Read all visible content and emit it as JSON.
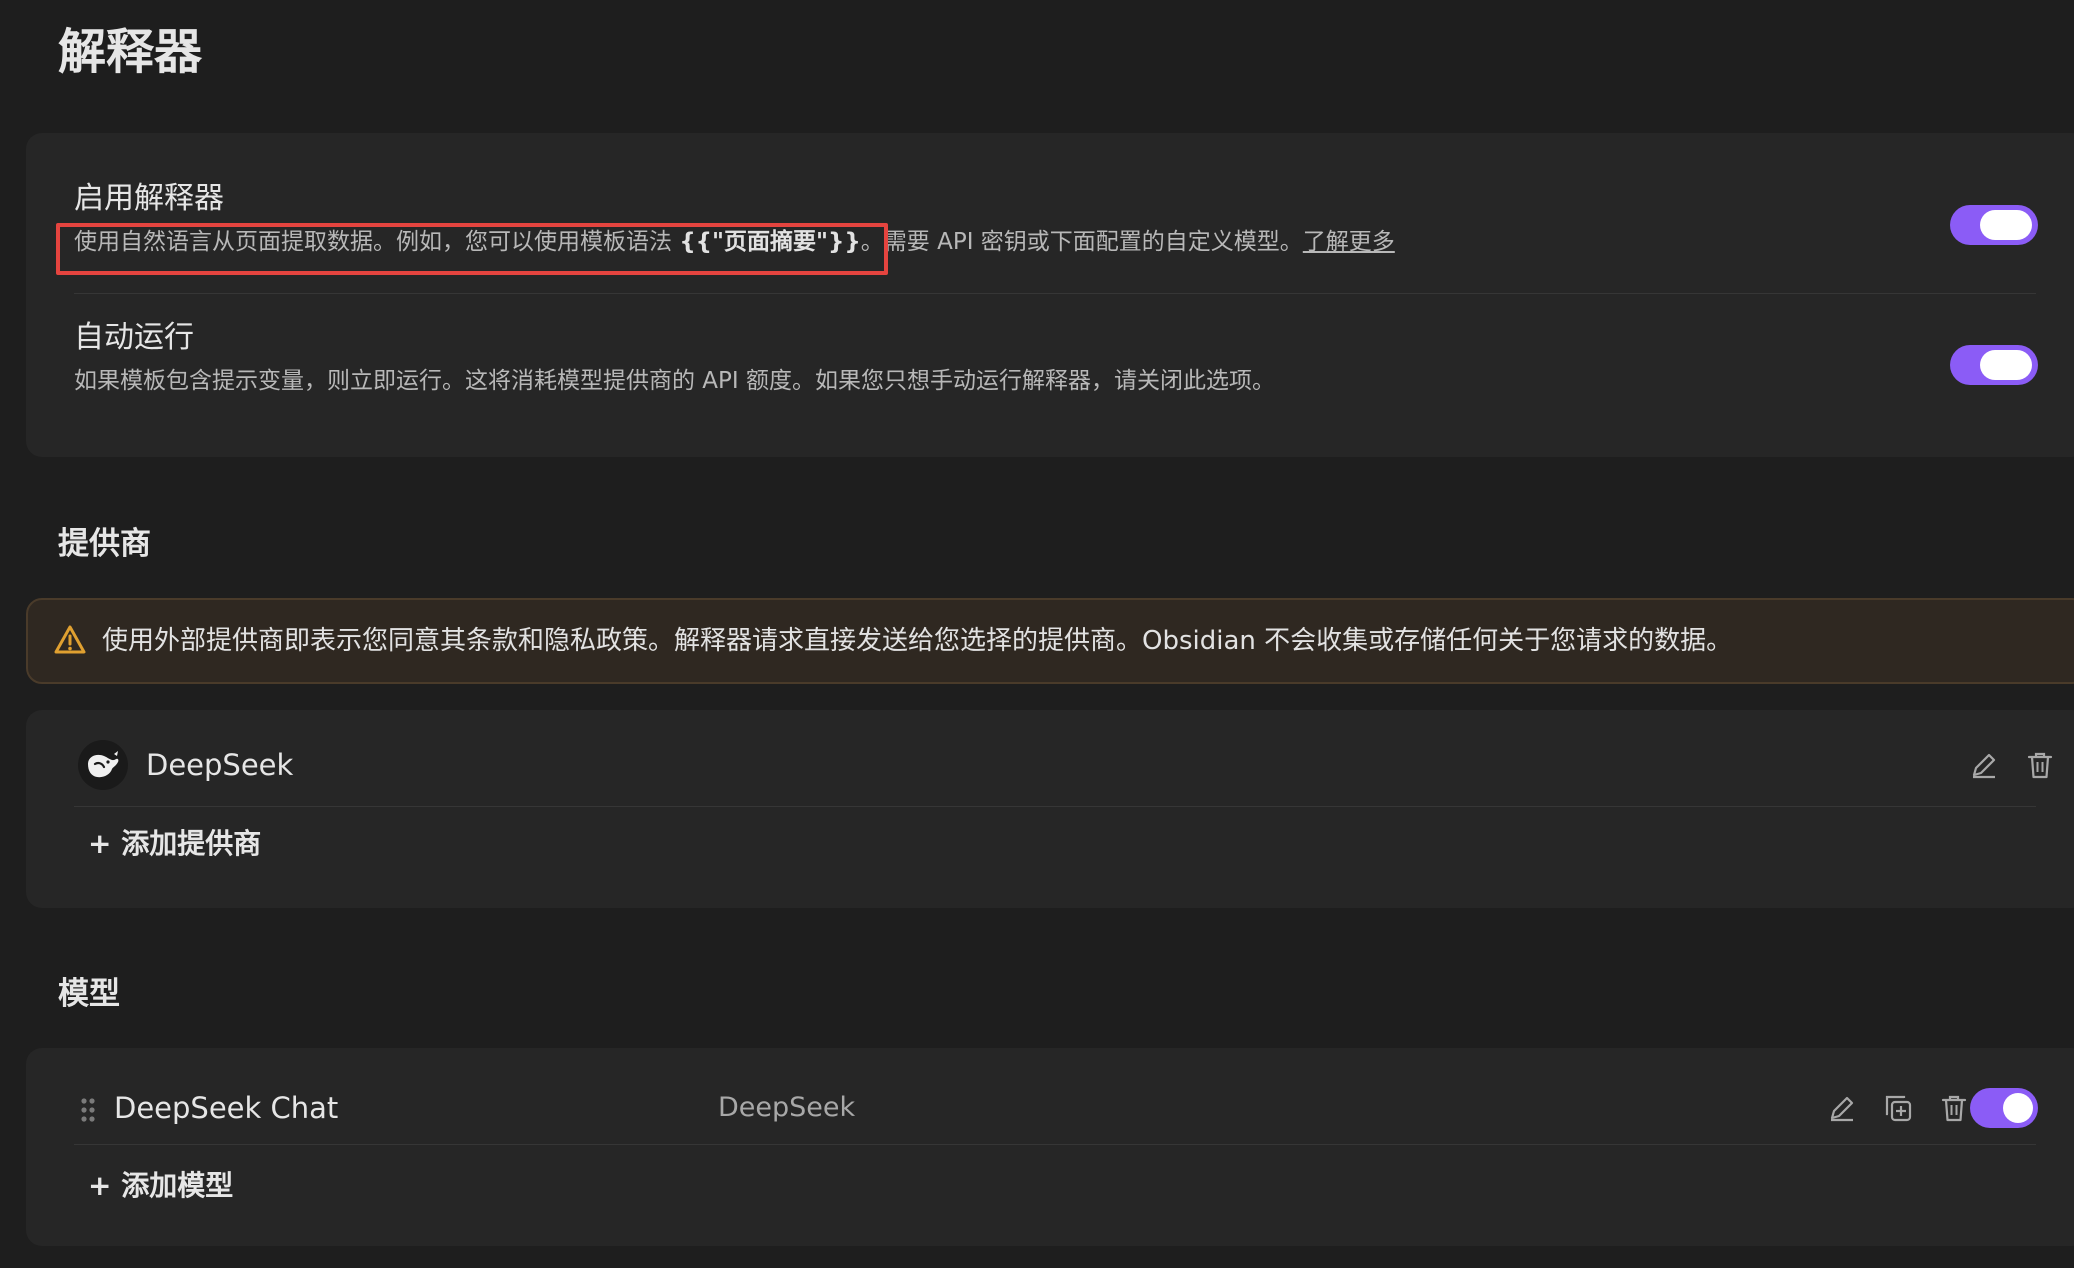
{
  "page": {
    "title": "解释器"
  },
  "settings": {
    "enable": {
      "name": "启用解释器",
      "desc_before": "使用自然语言从页面提取数据。例如，您可以使用模板语法 ",
      "desc_code": "{{\"页面摘要\"}}",
      "desc_after": "。需要 API 密钥或下面配置的自定义模型。",
      "learn_more": "了解更多",
      "enabled": true
    },
    "auto_run": {
      "name": "自动运行",
      "desc": "如果模板包含提示变量，则立即运行。这将消耗模型提供商的 API 额度。如果您只想手动运行解释器，请关闭此选项。",
      "enabled": true
    }
  },
  "providers": {
    "section_title": "提供商",
    "warning": "使用外部提供商即表示您同意其条款和隐私政策。解释器请求直接发送给您选择的提供商。Obsidian 不会收集或存储任何关于您请求的数据。",
    "items": [
      {
        "name": "DeepSeek",
        "icon": "deepseek-whale-icon"
      }
    ],
    "add_label": "+ 添加提供商"
  },
  "models": {
    "section_title": "模型",
    "items": [
      {
        "name": "DeepSeek Chat",
        "provider": "DeepSeek",
        "enabled": true
      }
    ],
    "add_label": "+ 添加模型"
  },
  "colors": {
    "background": "#1e1e1e",
    "card": "#262626",
    "accent": "#8b5cf6",
    "warning_bg": "#2f2821",
    "warning_icon": "#e0a030",
    "highlight": "#e5443f"
  }
}
